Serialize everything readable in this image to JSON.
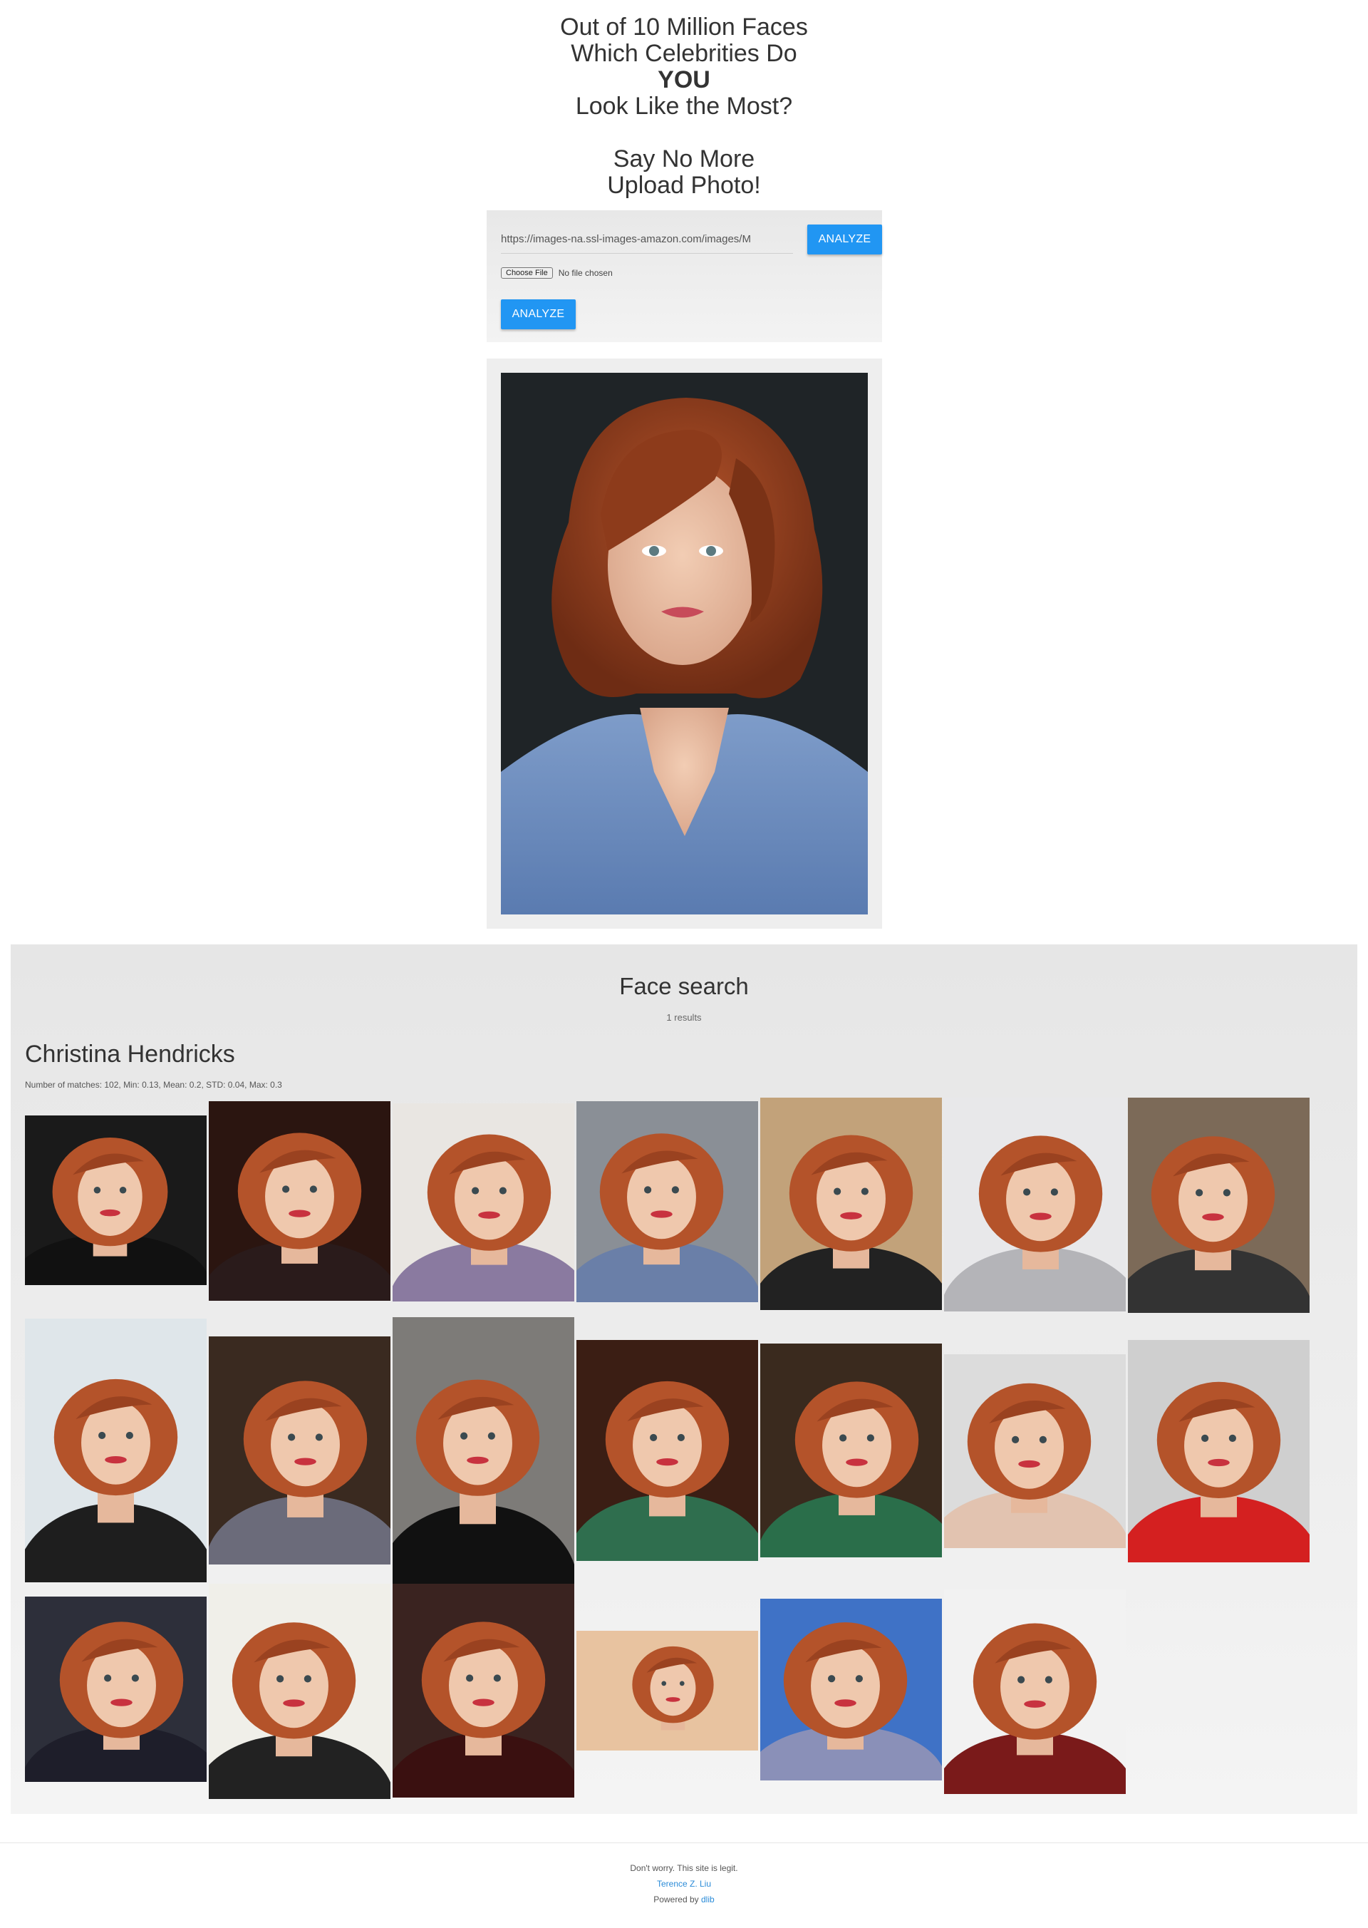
{
  "hero": {
    "line1": "Out of 10 Million Faces",
    "line2": "Which Celebrities Do",
    "line3": "YOU",
    "line4": "Look Like the Most?",
    "line5": "Say No More",
    "line6": "Upload Photo!"
  },
  "upload_form": {
    "url_value": "https://images-na.ssl-images-amazon.com/images/M",
    "url_button": "ANALYZE",
    "choose_file_label": "Choose File",
    "file_status": "No file chosen",
    "file_button": "ANALYZE"
  },
  "results": {
    "title": "Face search",
    "count": "1 results",
    "person": "Christina Hendricks",
    "stats": "Number of matches: 102, Min: 0.13, Mean: 0.2, STD: 0.04, Max: 0.3"
  },
  "footer": {
    "note": "Don't worry. This site is legit.",
    "author": "Terence Z. Liu",
    "powered_prefix": "Powered by ",
    "powered_link": "dlib"
  },
  "colors": {
    "accent": "#2196f3",
    "link": "#2a8bd8",
    "hair": "#b4532a",
    "dark_background": "#1d2124"
  }
}
